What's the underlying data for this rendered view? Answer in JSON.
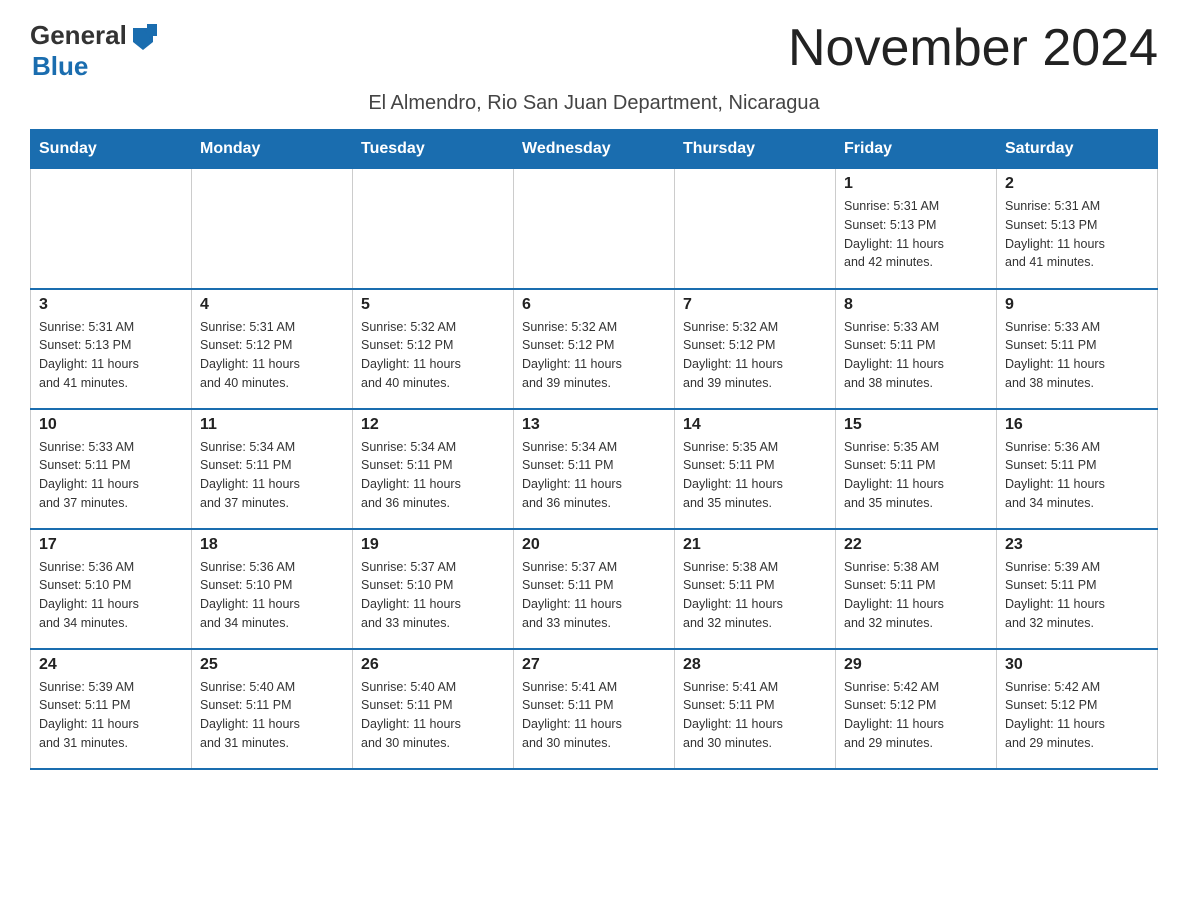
{
  "header": {
    "logo_general": "General",
    "logo_blue": "Blue",
    "month_title": "November 2024",
    "location": "El Almendro, Rio San Juan Department, Nicaragua"
  },
  "days_of_week": [
    "Sunday",
    "Monday",
    "Tuesday",
    "Wednesday",
    "Thursday",
    "Friday",
    "Saturday"
  ],
  "weeks": [
    [
      {
        "day": "",
        "info": ""
      },
      {
        "day": "",
        "info": ""
      },
      {
        "day": "",
        "info": ""
      },
      {
        "day": "",
        "info": ""
      },
      {
        "day": "",
        "info": ""
      },
      {
        "day": "1",
        "info": "Sunrise: 5:31 AM\nSunset: 5:13 PM\nDaylight: 11 hours\nand 42 minutes."
      },
      {
        "day": "2",
        "info": "Sunrise: 5:31 AM\nSunset: 5:13 PM\nDaylight: 11 hours\nand 41 minutes."
      }
    ],
    [
      {
        "day": "3",
        "info": "Sunrise: 5:31 AM\nSunset: 5:13 PM\nDaylight: 11 hours\nand 41 minutes."
      },
      {
        "day": "4",
        "info": "Sunrise: 5:31 AM\nSunset: 5:12 PM\nDaylight: 11 hours\nand 40 minutes."
      },
      {
        "day": "5",
        "info": "Sunrise: 5:32 AM\nSunset: 5:12 PM\nDaylight: 11 hours\nand 40 minutes."
      },
      {
        "day": "6",
        "info": "Sunrise: 5:32 AM\nSunset: 5:12 PM\nDaylight: 11 hours\nand 39 minutes."
      },
      {
        "day": "7",
        "info": "Sunrise: 5:32 AM\nSunset: 5:12 PM\nDaylight: 11 hours\nand 39 minutes."
      },
      {
        "day": "8",
        "info": "Sunrise: 5:33 AM\nSunset: 5:11 PM\nDaylight: 11 hours\nand 38 minutes."
      },
      {
        "day": "9",
        "info": "Sunrise: 5:33 AM\nSunset: 5:11 PM\nDaylight: 11 hours\nand 38 minutes."
      }
    ],
    [
      {
        "day": "10",
        "info": "Sunrise: 5:33 AM\nSunset: 5:11 PM\nDaylight: 11 hours\nand 37 minutes."
      },
      {
        "day": "11",
        "info": "Sunrise: 5:34 AM\nSunset: 5:11 PM\nDaylight: 11 hours\nand 37 minutes."
      },
      {
        "day": "12",
        "info": "Sunrise: 5:34 AM\nSunset: 5:11 PM\nDaylight: 11 hours\nand 36 minutes."
      },
      {
        "day": "13",
        "info": "Sunrise: 5:34 AM\nSunset: 5:11 PM\nDaylight: 11 hours\nand 36 minutes."
      },
      {
        "day": "14",
        "info": "Sunrise: 5:35 AM\nSunset: 5:11 PM\nDaylight: 11 hours\nand 35 minutes."
      },
      {
        "day": "15",
        "info": "Sunrise: 5:35 AM\nSunset: 5:11 PM\nDaylight: 11 hours\nand 35 minutes."
      },
      {
        "day": "16",
        "info": "Sunrise: 5:36 AM\nSunset: 5:11 PM\nDaylight: 11 hours\nand 34 minutes."
      }
    ],
    [
      {
        "day": "17",
        "info": "Sunrise: 5:36 AM\nSunset: 5:10 PM\nDaylight: 11 hours\nand 34 minutes."
      },
      {
        "day": "18",
        "info": "Sunrise: 5:36 AM\nSunset: 5:10 PM\nDaylight: 11 hours\nand 34 minutes."
      },
      {
        "day": "19",
        "info": "Sunrise: 5:37 AM\nSunset: 5:10 PM\nDaylight: 11 hours\nand 33 minutes."
      },
      {
        "day": "20",
        "info": "Sunrise: 5:37 AM\nSunset: 5:11 PM\nDaylight: 11 hours\nand 33 minutes."
      },
      {
        "day": "21",
        "info": "Sunrise: 5:38 AM\nSunset: 5:11 PM\nDaylight: 11 hours\nand 32 minutes."
      },
      {
        "day": "22",
        "info": "Sunrise: 5:38 AM\nSunset: 5:11 PM\nDaylight: 11 hours\nand 32 minutes."
      },
      {
        "day": "23",
        "info": "Sunrise: 5:39 AM\nSunset: 5:11 PM\nDaylight: 11 hours\nand 32 minutes."
      }
    ],
    [
      {
        "day": "24",
        "info": "Sunrise: 5:39 AM\nSunset: 5:11 PM\nDaylight: 11 hours\nand 31 minutes."
      },
      {
        "day": "25",
        "info": "Sunrise: 5:40 AM\nSunset: 5:11 PM\nDaylight: 11 hours\nand 31 minutes."
      },
      {
        "day": "26",
        "info": "Sunrise: 5:40 AM\nSunset: 5:11 PM\nDaylight: 11 hours\nand 30 minutes."
      },
      {
        "day": "27",
        "info": "Sunrise: 5:41 AM\nSunset: 5:11 PM\nDaylight: 11 hours\nand 30 minutes."
      },
      {
        "day": "28",
        "info": "Sunrise: 5:41 AM\nSunset: 5:11 PM\nDaylight: 11 hours\nand 30 minutes."
      },
      {
        "day": "29",
        "info": "Sunrise: 5:42 AM\nSunset: 5:12 PM\nDaylight: 11 hours\nand 29 minutes."
      },
      {
        "day": "30",
        "info": "Sunrise: 5:42 AM\nSunset: 5:12 PM\nDaylight: 11 hours\nand 29 minutes."
      }
    ]
  ]
}
